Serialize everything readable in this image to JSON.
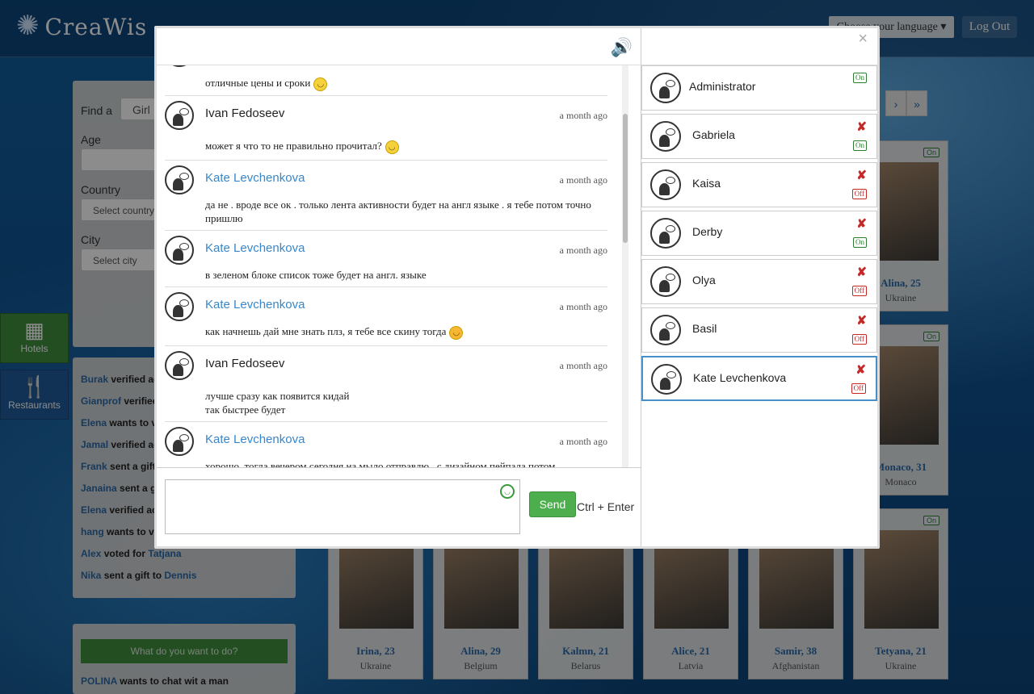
{
  "brand": {
    "logo": "CreaWis"
  },
  "header": {
    "language_label": "Choose your language",
    "logout_label": "Log Out"
  },
  "search": {
    "find_label": "Find a",
    "find_value": "Girl",
    "age_label": "Age",
    "country_label": "Country",
    "country_placeholder": "Select country",
    "city_label": "City",
    "city_placeholder": "Select city"
  },
  "side_buttons": [
    {
      "label": "Hotels",
      "icon": "building-icon"
    },
    {
      "label": "Restaurants",
      "icon": "fork-knife-icon"
    }
  ],
  "activity": [
    {
      "name": "Burak",
      "action": "verified ac"
    },
    {
      "name": "Gianprof",
      "action": "verified"
    },
    {
      "name": "Elena",
      "action": "wants to v"
    },
    {
      "name": "Jamal",
      "action": "verified ac"
    },
    {
      "name": "Frank",
      "action": "sent a gift"
    },
    {
      "name": "Janaina",
      "action": "sent a g"
    },
    {
      "name": "Elena",
      "action": "verified ac"
    },
    {
      "name": "hang",
      "action": "wants to v"
    },
    {
      "name": "Alex",
      "action": "voted for",
      "target": "Tatjana"
    },
    {
      "name": "Nika",
      "action": "sent a gift to",
      "target": "Dennis"
    }
  ],
  "todo": {
    "button": "What do you want to do?",
    "first": {
      "name": "POLINA",
      "text": "wants to chat wit a man"
    }
  },
  "pager": {
    "next": "›",
    "last": "»"
  },
  "profiles_right": [
    {
      "name": "Alina, 25",
      "country": "Ukraine",
      "status": "On"
    },
    {
      "name": "Monaco, 31",
      "country": "Monaco",
      "status": "On"
    }
  ],
  "profiles_bottom": [
    {
      "name": "Irina, 23",
      "country": "Ukraine"
    },
    {
      "name": "Alina, 29",
      "country": "Belgium"
    },
    {
      "name": "Kalmn, 21",
      "country": "Belarus"
    },
    {
      "name": "Alice, 21",
      "country": "Latvia"
    },
    {
      "name": "Samir, 38",
      "country": "Afghanistan"
    },
    {
      "name": "Tetyana, 21",
      "country": "Ukraine",
      "status": "On"
    }
  ],
  "chat": {
    "close": "×",
    "messages": [
      {
        "author": "",
        "time": "",
        "text": "отличные цены и сроки",
        "smile": true
      },
      {
        "author": "Ivan Fedoseev",
        "link": false,
        "time": "a month ago",
        "text": "может я что то не правильно прочитал?",
        "smile": true
      },
      {
        "author": "Kate Levchenkova",
        "link": true,
        "time": "a month ago",
        "text": "да не . вроде все ок . только лента активности будет на англ языке . я тебе потом точно пришлю",
        "smile": false
      },
      {
        "author": "Kate Levchenkova",
        "link": true,
        "time": "a month ago",
        "text": "в зеленом блоке список тоже будет на англ. языке",
        "smile": false
      },
      {
        "author": "Kate Levchenkova",
        "link": true,
        "time": "a month ago",
        "text": "как начнешь дай мне знать  плз, я тебе все скину тогда",
        "smile": true
      },
      {
        "author": "Ivan Fedoseev",
        "link": false,
        "time": "a month ago",
        "text": "лучше сразу как появится кидай\nтак быстрее будет",
        "smile": false
      },
      {
        "author": "Kate Levchenkova",
        "link": true,
        "time": "a month ago",
        "text": "хорошо, тогда вечером сегодня на мыло отправлю . с дизайном пейпала потом",
        "smile": false
      }
    ],
    "send_label": "Send",
    "hint": "Ctrl + Enter"
  },
  "contacts": [
    {
      "name": "Administrator",
      "status": "On",
      "deletable": false
    },
    {
      "name": "Gabriela",
      "status": "On",
      "deletable": true
    },
    {
      "name": "Kaisa",
      "status": "Off",
      "deletable": true
    },
    {
      "name": "Derby",
      "status": "On",
      "deletable": true
    },
    {
      "name": "Olya",
      "status": "Off",
      "deletable": true
    },
    {
      "name": "Basil",
      "status": "Off",
      "deletable": true
    },
    {
      "name": "Kate Levchenkova",
      "status": "Off",
      "deletable": true,
      "active": true
    }
  ]
}
